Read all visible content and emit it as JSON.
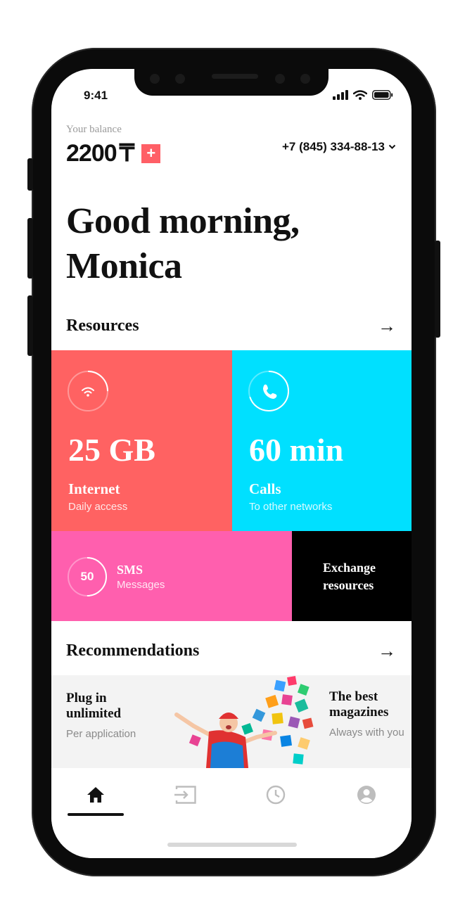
{
  "status_bar": {
    "time": "9:41"
  },
  "balance": {
    "label": "Your balance",
    "amount": "2200",
    "currency": "₸",
    "topup_symbol": "+"
  },
  "account": {
    "phone": "+7 (845) 334-88-13"
  },
  "greeting": {
    "line1": "Good morning,",
    "line2": "Monica"
  },
  "resources": {
    "title": "Resources",
    "arrow": "→",
    "internet": {
      "value": "25 GB",
      "title": "Internet",
      "subtitle": "Daily access",
      "color": "#ff6262",
      "remaining_fraction": 0.25
    },
    "calls": {
      "value": "60 min",
      "title": "Calls",
      "subtitle": "To other networks",
      "color": "#00e0ff",
      "remaining_fraction": 0.7
    },
    "sms": {
      "count": "50",
      "title": "SMS",
      "subtitle": "Messages",
      "color": "#ff5fae",
      "remaining_fraction": 0.5
    },
    "exchange": {
      "line1": "Exchange",
      "line2": "resources",
      "color": "#000000"
    }
  },
  "recommendations": {
    "title": "Recommendations",
    "arrow": "→",
    "items": [
      {
        "title_line1": "Plug in",
        "title_line2": "unlimited",
        "subtitle": "Per application"
      },
      {
        "title_line1": "The best",
        "title_line2": "magazines",
        "subtitle": "Always with you"
      }
    ]
  },
  "tabbar": {
    "tabs": [
      {
        "icon": "home-icon",
        "active": true
      },
      {
        "icon": "transfer-icon",
        "active": false
      },
      {
        "icon": "history-clock-icon",
        "active": false
      },
      {
        "icon": "profile-icon",
        "active": false
      }
    ]
  }
}
